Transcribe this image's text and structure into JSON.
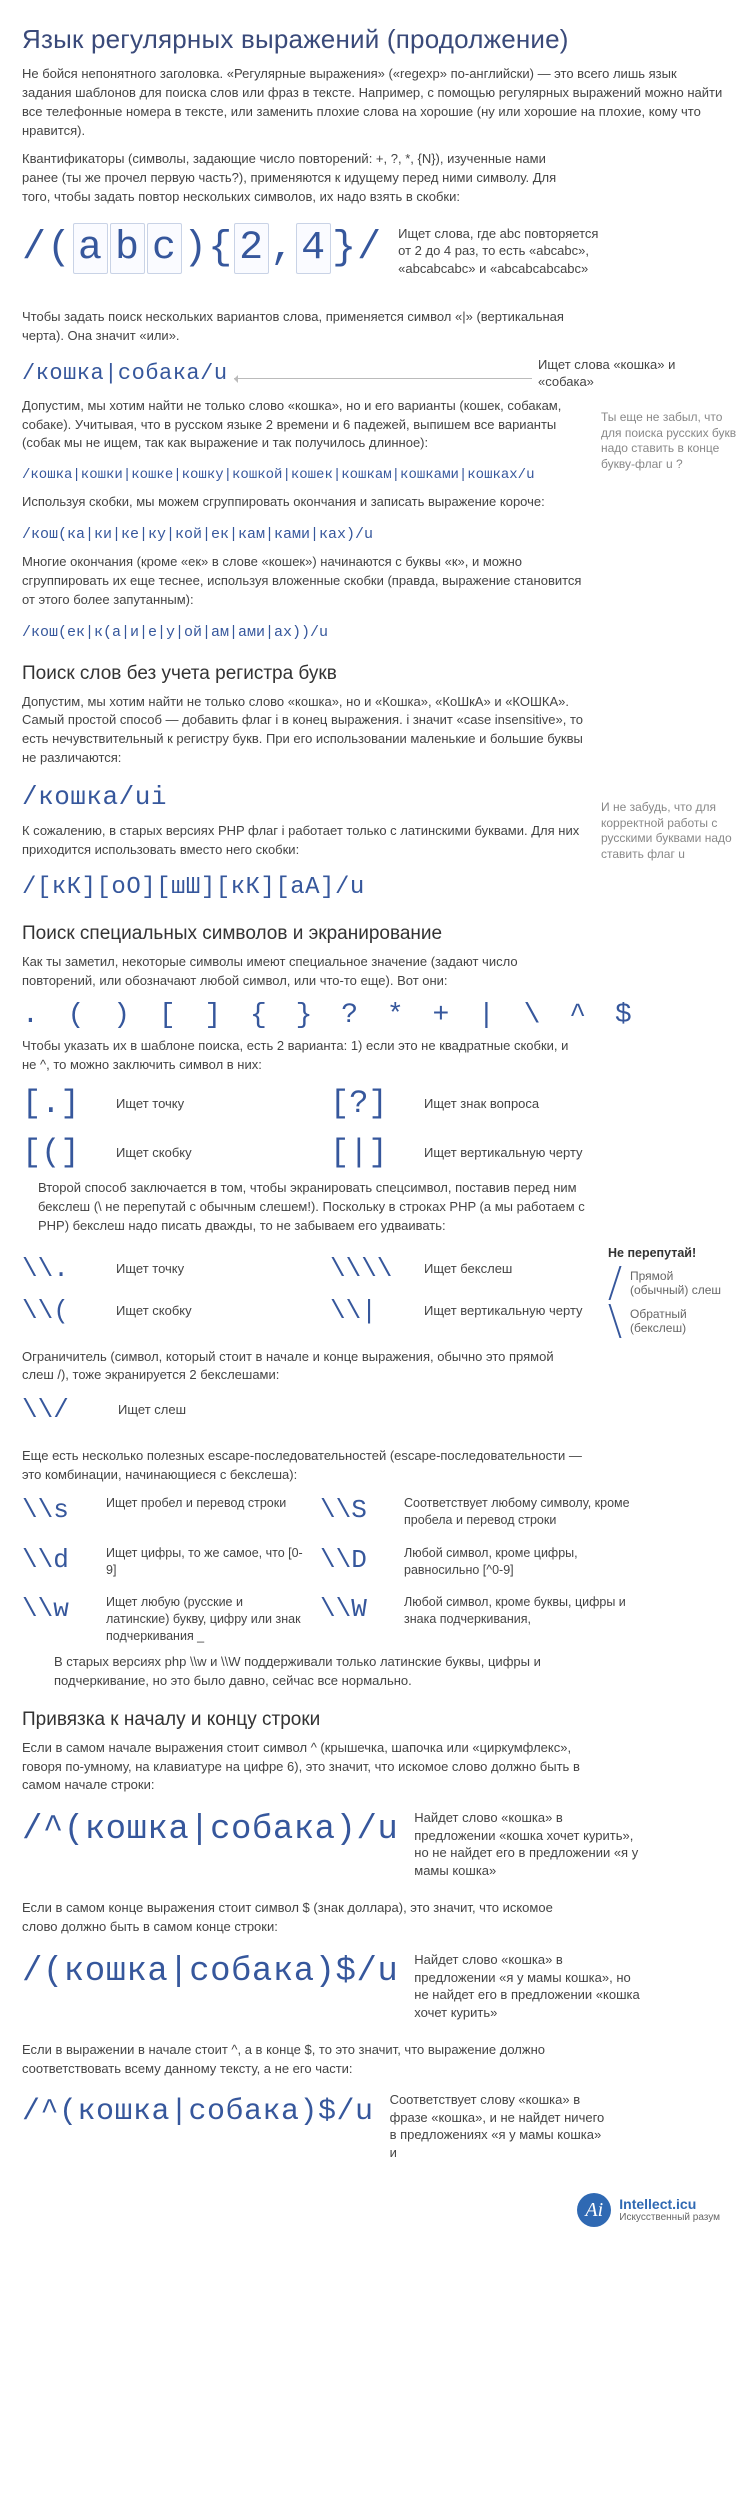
{
  "title": "Язык регулярных выражений (продолжение)",
  "intro1": "Не бойся непонятного заголовка. «Регулярные выражения» («regexp» по-английски) — это всего лишь язык задания шаблонов для поиска слов или фраз в тексте. Например, с помощью регулярных выражений можно найти все телефонные номера в тексте, или заменить плохие слова на хорошие (ну или хорошие на плохие, кому что нравится).",
  "intro2": "Квантификаторы (символы, задающие число повторений: +, ?, *, {N}), изученные нами ранее (ты же прочел первую часть?), применяются к идущему перед ними символу. Для того, чтобы задать повтор нескольких символов, их надо взять в скобки:",
  "ex1_prefix": "/(",
  "ex1_a": "a",
  "ex1_b": "b",
  "ex1_c": "c",
  "ex1_mid": "){",
  "ex1_n1": "2",
  "ex1_comma": ",",
  "ex1_n2": "4",
  "ex1_suffix": "}/",
  "ex1_explain": "Ищет слова, где abc повторяется от 2 до 4 раз, то есть «abcabc», «abcabcabc» и «abcabcabcabc»",
  "para_or": "Чтобы задать поиск нескольких вариантов слова, применяется символ «|» (вертикальная черта). Она значит «или».",
  "regex_or": "/кошка|собака/u",
  "regex_or_explain": "Ищет слова «кошка» и «собака»",
  "side_note_u": "Ты еще не забыл, что для поиска русских букв надо ставить в конце букву-флаг u ?",
  "para_variants": "Допустим, мы хотим найти не только слово «кошка», но и его варианты (кошек, собакам, собаке). Учитывая, что в русском языке 2 времени и 6 падежей, выпишем все варианты (собак мы не ищем, так как выражение и так получилось длинное):",
  "regex_variants": "/кошка|кошки|кошке|кошку|кошкой|кошек|кошкам|кошками|кошках/u",
  "para_group": "Используя скобки, мы можем сгруппировать окончания и записать выражение короче:",
  "regex_group": "/кош(ка|ки|ке|ку|кой|ек|кам|ками|ках)/u",
  "para_nested": "Многие окончания (кроме «ек» в слове «кошек») начинаются с буквы «к», и можно сгруппировать их еще теснее, используя вложенные скобки (правда, выражение становится от этого более запутанным):",
  "regex_nested": "/кош(ек|к(а|и|е|у|ой|ам|ами|ах))/u",
  "h2_case": "Поиск слов без учета регистра букв",
  "para_case": "Допустим, мы хотим найти не только слово «кошка», но и «Кошка», «КоШкА» и «КОШКА». Самый простой способ — добавить флаг i в конец выражения. i значит «case insensitive», то есть нечувствительный к регистру букв. При его использовании маленькие и большие буквы не различаются:",
  "side_note_i": "И не забудь, что для корректной работы с русскими буквами надо ставить флаг u",
  "regex_i": "/кошка/ui",
  "para_oldphp": "К сожалению, в старых версиях PHP флаг i работает только с латинскими буквами. Для них приходится использовать вместо него скобки:",
  "regex_oldphp": "/[кК][оО][шШ][кК][аА]/u",
  "h2_esc": "Поиск специальных символов и экранирование",
  "para_special": "Как ты заметил, некоторые символы имеют специальное значение (задают число повторений, или обозначают любой символ, или что-то еще). Вот они:",
  "sym_line": ". ( ) [ ] { } ? * + | \\ ^ $",
  "para_two_ways": "Чтобы указать их в шаблоне поиска, есть 2 варианта: 1) если это не квадратные скобки, и не ^, то можно заключить символ в них:",
  "br_dot": "[.]",
  "br_dot_lbl": "Ищет точку",
  "br_q": "[?]",
  "br_q_lbl": "Ищет знак вопроса",
  "br_p": "[(]",
  "br_p_lbl": "Ищет скобку",
  "br_v": "[|]",
  "br_v_lbl": "Ищет вертикальную черту",
  "para_backslash": "Второй способ заключается в том, чтобы экранировать спецсимвол, поставив перед ним бекслеш (\\ не перепутай с обычным слешем!). Поскольку в строках PHP (а мы работаем с PHP) бекслеш надо писать дважды, то не забываем его удваивать:",
  "esc_dot": "\\\\.",
  "esc_dot_lbl": "Ищет точку",
  "esc_bs": "\\\\\\\\",
  "esc_bs_lbl": "Ищет бекслеш",
  "esc_p": "\\\\(",
  "esc_p_lbl": "Ищет скобку",
  "esc_v": "\\\\|",
  "esc_v_lbl": "Ищет вертикальную черту",
  "warn_title": "Не перепутай!",
  "warn_fwd": "Прямой (обычный) слеш",
  "warn_back": "Обратный (бекслеш)",
  "para_delim": "Ограничитель (символ, который стоит в начале и конце выражения, обычно это прямой слеш /), тоже экранируется 2 бекслешами:",
  "esc_slash": "\\\\/",
  "esc_slash_lbl": "Ищет слеш",
  "para_escape_seq": "Еще есть несколько полезных escape-последовательностей (escape-последовательности — это комбинации, начинающиеся с бекслеша):",
  "seq_s": "\\\\s",
  "seq_s_lbl": "Ищет пробел и перевод строки",
  "seq_S": "\\\\S",
  "seq_S_lbl": "Соответствует любому символу, кроме пробела и перевод строки",
  "seq_d": "\\\\d",
  "seq_d_lbl": "Ищет цифры, то же самое, что [0-9]",
  "seq_D": "\\\\D",
  "seq_D_lbl": "Любой символ, кроме цифры, равносильно [^0-9]",
  "seq_w": "\\\\w",
  "seq_w_lbl": "Ищет любую (русские и латинские) букву, цифру или знак подчеркивания _",
  "seq_W": "\\\\W",
  "seq_W_lbl": "Любой символ, кроме буквы, цифры и знака подчеркивания,",
  "para_old_wW": "В старых версиях php \\\\w и \\\\W поддерживали только латинские буквы, цифры и подчеркивание, но это было давно, сейчас все нормально.",
  "h2_anchor": "Привязка к началу и концу строки",
  "para_caret": "Если в самом начале выражения стоит символ ^ (крышечка, шапочка или «циркумфлекс», говоря по-умному, на клавиатуре на цифре 6), это значит, что искомое слово должно быть в самом начале строки:",
  "regex_caret": "/^(кошка|собака)/u",
  "regex_caret_explain": "Найдет слово «кошка» в предложении «кошка хочет курить», но не найдет его в предложении «я у мамы кошка»",
  "para_dollar": "Если в самом конце выражения стоит символ $ (знак доллара), это значит, что искомое слово должно быть в самом конце строки:",
  "regex_dollar": "/(кошка|собака)$/u",
  "regex_dollar_explain": "Найдет слово «кошка» в предложении «я у мамы кошка», но не найдет его в предложении «кошка хочет курить»",
  "para_both": "Если в выражении в начале стоит ^, а в конце $, то это значит, что выражение должно соответствовать всему данному тексту, а не его части:",
  "regex_both": "/^(кошка|собака)$/u",
  "regex_both_explain": "Соответствует слову «кошка» в фразе «кошка», и не найдет ничего в предложениях «я у мамы кошка» и",
  "logo_text": "Intellect.icu",
  "logo_sub": "Искусственный разум"
}
